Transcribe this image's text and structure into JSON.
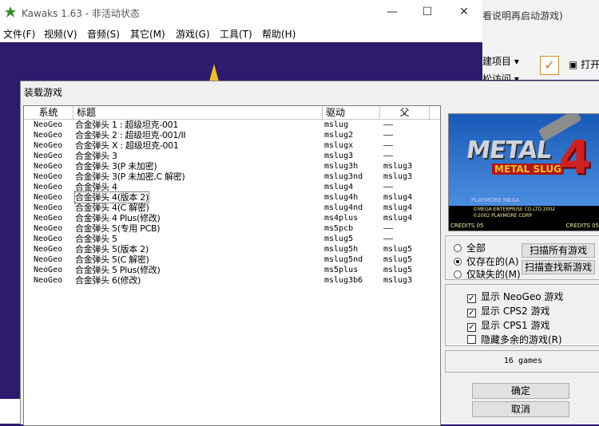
{
  "kawaks": {
    "title": "Kawaks 1.63 - 非活动状态",
    "menu": [
      "文件(F)",
      "视频(V)",
      "音频(S)",
      "其它(M)",
      "游戏(G)",
      "工具(T)",
      "帮助(H)"
    ]
  },
  "background_window": {
    "hint_text": "看说明再启动游戏)",
    "ribbon_new_item": "建项目 ▾",
    "ribbon_easy_access": "松访问 ▾",
    "open_label": "打开"
  },
  "dialog": {
    "title": "装载游戏",
    "columns": [
      "系统",
      "标题",
      "驱动",
      "父"
    ],
    "games": [
      {
        "system": "NeoGeo",
        "title": "合金弹头 1 : 超级坦克-001",
        "driver": "mslug",
        "parent": "——"
      },
      {
        "system": "NeoGeo",
        "title": "合金弹头 2 : 超级坦克-001/II",
        "driver": "mslug2",
        "parent": "——"
      },
      {
        "system": "NeoGeo",
        "title": "合金弹头 X : 超级坦克-001",
        "driver": "mslugx",
        "parent": "——"
      },
      {
        "system": "NeoGeo",
        "title": "合金弹头 3",
        "driver": "mslug3",
        "parent": "——"
      },
      {
        "system": "NeoGeo",
        "title": "合金弹头 3(P 未加密)",
        "driver": "mslug3h",
        "parent": "mslug3"
      },
      {
        "system": "NeoGeo",
        "title": "合金弹头 3(P 未加密,C 解密)",
        "driver": "mslug3nd",
        "parent": "mslug3"
      },
      {
        "system": "NeoGeo",
        "title": "合金弹头 4",
        "driver": "mslug4",
        "parent": "——"
      },
      {
        "system": "NeoGeo",
        "title": "合金弹头 4(版本 2)",
        "driver": "mslug4h",
        "parent": "mslug4"
      },
      {
        "system": "NeoGeo",
        "title": "合金弹头 4(C 解密)",
        "driver": "mslug4nd",
        "parent": "mslug4"
      },
      {
        "system": "NeoGeo",
        "title": "合金弹头 4 Plus(修改)",
        "driver": "ms4plus",
        "parent": "mslug4"
      },
      {
        "system": "NeoGeo",
        "title": "合金弹头 5(专用 PCB)",
        "driver": "ms5pcb",
        "parent": "——"
      },
      {
        "system": "NeoGeo",
        "title": "合金弹头 5",
        "driver": "mslug5",
        "parent": "——"
      },
      {
        "system": "NeoGeo",
        "title": "合金弹头 5(版本 2)",
        "driver": "mslug5h",
        "parent": "mslug5"
      },
      {
        "system": "NeoGeo",
        "title": "合金弹头 5(C 解密)",
        "driver": "mslug5nd",
        "parent": "mslug5"
      },
      {
        "system": "NeoGeo",
        "title": "合金弹头 5 Plus(修改)",
        "driver": "ms5plus",
        "parent": "mslug5"
      },
      {
        "system": "NeoGeo",
        "title": "合金弹头 6(修改)",
        "driver": "mslug3b6",
        "parent": "mslug3"
      }
    ],
    "focused_row": 7,
    "preview": {
      "logo_text": "METAL",
      "logo_sub": "METAL SLUG",
      "logo_number": "4",
      "publisher": "PLAYMORE  MEGA",
      "copyright1": "©MEGA ENTERPRISE CO.LTD.2002",
      "copyright2": "©2002 PLAYMORE CORP.",
      "credits_left": "CREDITS 05",
      "credits_right": "CREDITS 05"
    },
    "filter": {
      "all_label": "全部",
      "existing_label": "仅存在的(A)",
      "missing_label": "仅缺失的(M)",
      "selected": "existing",
      "scan_all_button": "扫描所有游戏",
      "scan_new_button": "扫描查找新游戏"
    },
    "show": {
      "neogeo_label": "显示 NeoGeo 游戏",
      "cps2_label": "显示 CPS2 游戏",
      "cps1_label": "显示 CPS1 游戏",
      "hide_extra_label": "隐藏多余的游戏(R)",
      "neogeo_checked": true,
      "cps2_checked": true,
      "cps1_checked": true,
      "hide_extra_checked": false
    },
    "count_text": "16 games",
    "ok_button": "确定",
    "cancel_button": "取消"
  }
}
